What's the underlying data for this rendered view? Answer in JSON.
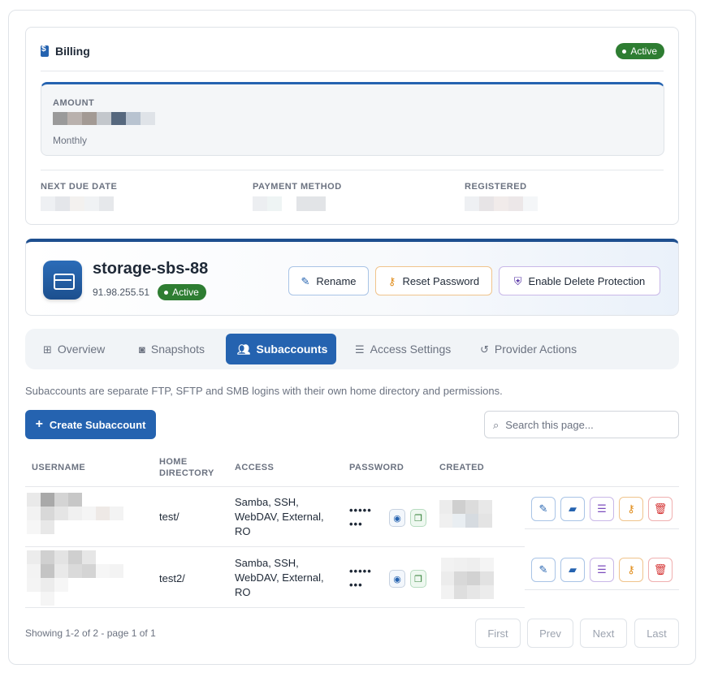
{
  "billing": {
    "title": "Billing",
    "status": "Active",
    "amount_label": "AMOUNT",
    "cycle": "Monthly",
    "next_due_label": "NEXT DUE DATE",
    "payment_method_label": "PAYMENT METHOD",
    "registered_label": "REGISTERED"
  },
  "server": {
    "name": "storage-sbs-88",
    "ip": "91.98.255.51",
    "status": "Active",
    "rename_label": "Rename",
    "reset_password_label": "Reset Password",
    "delete_protection_label": "Enable Delete Protection"
  },
  "tabs": [
    {
      "label": "Overview",
      "icon": "grid-icon"
    },
    {
      "label": "Snapshots",
      "icon": "camera-icon"
    },
    {
      "label": "Subaccounts",
      "icon": "users-icon",
      "active": true
    },
    {
      "label": "Access Settings",
      "icon": "sliders-icon"
    },
    {
      "label": "Provider Actions",
      "icon": "history-icon"
    }
  ],
  "intro_text": "Subaccounts are separate FTP, SFTP and SMB logins with their own home directory and permissions.",
  "create_button_label": "Create Subaccount",
  "search": {
    "placeholder": "Search this page..."
  },
  "table": {
    "headers": {
      "username": "USERNAME",
      "home_line1": "HOME",
      "home_line2": "DIRECTORY",
      "access": "ACCESS",
      "password": "PASSWORD",
      "created": "CREATED"
    },
    "rows": [
      {
        "home_directory": "test/",
        "access_lines": [
          "Samba, SSH,",
          "WebDAV, External,",
          "RO"
        ],
        "password_line1": "•••••",
        "password_line2": "•••"
      },
      {
        "home_directory": "test2/",
        "access_lines": [
          "Samba, SSH,",
          "WebDAV, External,",
          "RO"
        ],
        "password_line1": "•••••",
        "password_line2": "•••"
      }
    ]
  },
  "pagination": {
    "summary": "Showing 1-2 of 2 - page 1 of 1",
    "first": "First",
    "prev": "Prev",
    "next": "Next",
    "last": "Last"
  },
  "colors": {
    "primary": "#2563b0",
    "success": "#2e7d32",
    "warning": "#e08a16",
    "danger": "#d32f2f",
    "purple": "#7c4dbd"
  }
}
